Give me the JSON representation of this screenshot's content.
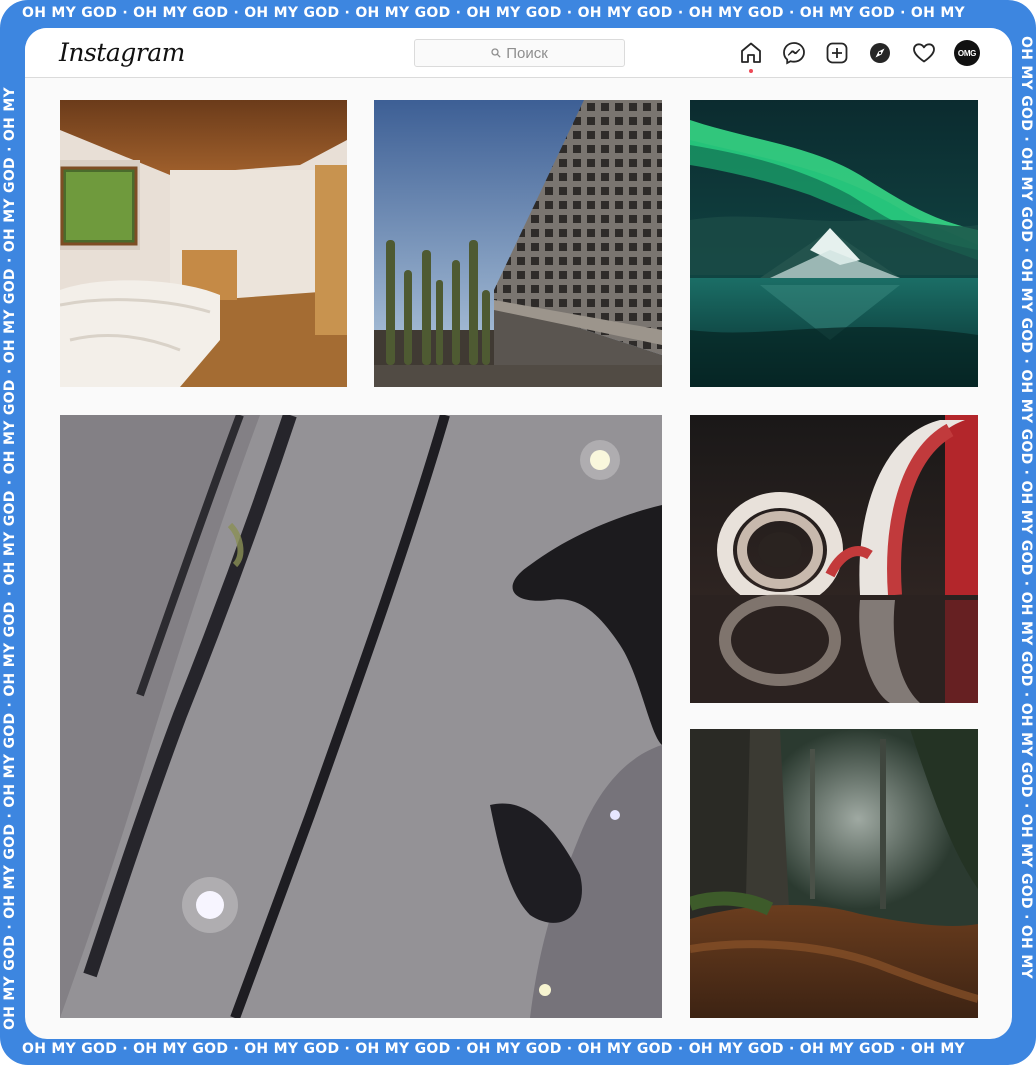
{
  "frame": {
    "marquee_top": "OH MY GOD · OH MY GOD · OH MY GOD · OH MY GOD · OH MY GOD · OH MY GOD · OH MY GOD · OH MY GOD · OH MY",
    "marquee_bottom": "OH MY GOD · OH MY GOD · OH MY GOD · OH MY GOD · OH MY GOD · OH MY GOD · OH MY GOD · OH MY GOD · OH MY",
    "marquee_left": "OH MY GOD · OH MY GOD · OH MY GOD · OH MY GOD · OH MY GOD · OH MY GOD · OH MY GOD · OH MY GOD · OH MY",
    "marquee_right": "OH MY GOD · OH MY GOD · OH MY GOD · OH MY GOD · OH MY GOD · OH MY GOD · OH MY GOD · OH MY GOD · OH MY",
    "frame_color": "#3d86e0"
  },
  "header": {
    "logo": "Instagram",
    "search_placeholder": "Поиск",
    "nav_icons": [
      "home-icon",
      "messenger-icon",
      "new-post-icon",
      "explore-icon",
      "heart-icon",
      "profile-avatar"
    ],
    "avatar_text": "OMG",
    "active_dot_color": "#ed4956"
  },
  "grid": {
    "tiles": [
      {
        "subject": "bedroom-wood-ceiling"
      },
      {
        "subject": "concrete-building-cactus"
      },
      {
        "subject": "aurora-mountain"
      },
      {
        "subject": "video-rocky-surface",
        "video": true
      },
      {
        "subject": "spiral-bookstore"
      },
      {
        "subject": "misty-forest-path"
      }
    ]
  }
}
